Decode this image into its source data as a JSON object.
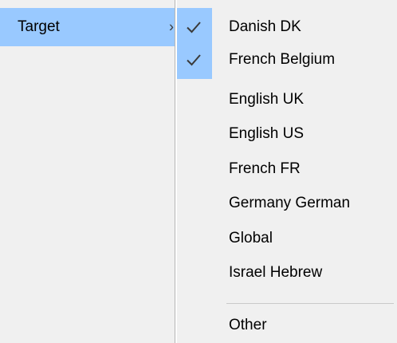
{
  "parent_menu": {
    "item": {
      "label": "Target",
      "has_submenu_arrow": true,
      "arrow": "›",
      "highlight_color": "#99c9ff"
    }
  },
  "submenu": {
    "items": [
      {
        "label": "Danish DK",
        "checked": true
      },
      {
        "label": "French Belgium",
        "checked": true
      },
      {
        "label": "English UK",
        "checked": false
      },
      {
        "label": "English US",
        "checked": false
      },
      {
        "label": "French FR",
        "checked": false
      },
      {
        "label": "Germany German",
        "checked": false
      },
      {
        "label": "Global",
        "checked": false
      },
      {
        "label": "Israel Hebrew",
        "checked": false
      }
    ],
    "after_separator": [
      {
        "label": "Other",
        "checked": false
      }
    ],
    "check_icon": "checkmark-icon",
    "menu_background": "#f0f0f0"
  }
}
